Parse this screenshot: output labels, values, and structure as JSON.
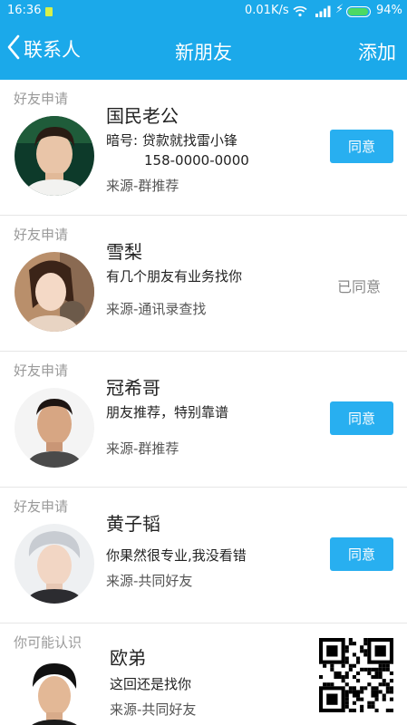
{
  "status_bar": {
    "time": "16:36",
    "network_speed": "0.01K/s",
    "battery_percent": "94%",
    "battery_level": 0.94,
    "icons": [
      "sim-icon",
      "wifi-icon",
      "signal-icon",
      "charging-icon",
      "battery-icon"
    ]
  },
  "nav": {
    "back_label": "联系人",
    "title": "新朋友",
    "add_label": "添加"
  },
  "requests": [
    {
      "tag": "好友申请",
      "name": "国民老公",
      "message_line1": "暗号: 贷款就找雷小锋",
      "message_line2": "158-0000-0000",
      "source": "来源-群推荐",
      "action": "同意",
      "accepted": false
    },
    {
      "tag": "好友申请",
      "name": "雪梨",
      "message_line1": "有几个朋友有业务找你",
      "source": "来源-通讯录查找",
      "action": "已同意",
      "accepted": true
    },
    {
      "tag": "好友申请",
      "name": "冠希哥",
      "message_line1": "朋友推荐，特别靠谱",
      "source": "来源-群推荐",
      "action": "同意",
      "accepted": false
    },
    {
      "tag": "好友申请",
      "name": "黄子韬",
      "message_line1": "你果然很专业,我没看错",
      "source": "来源-共同好友",
      "action": "同意",
      "accepted": false
    },
    {
      "tag": "你可能认识",
      "name": "欧弟",
      "message_line1": "这回还是找你",
      "source": "来源-共同好友"
    }
  ],
  "colors": {
    "brand_blue": "#1ba9ea",
    "button_blue": "#28aff0",
    "divider": "#e6e6e6"
  }
}
